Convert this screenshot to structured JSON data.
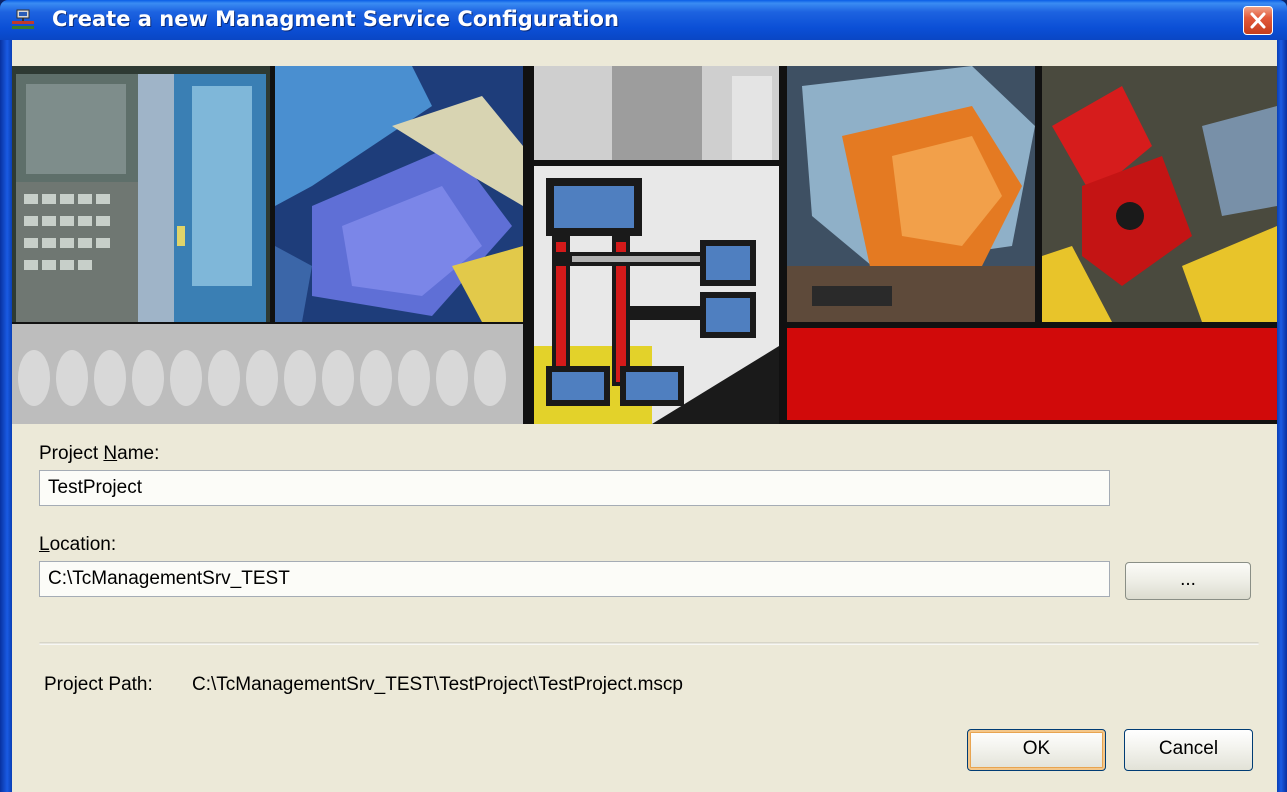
{
  "window": {
    "title": "Create a new Managment Service Configuration",
    "icon": "app-network-icon",
    "close_icon": "close-icon"
  },
  "banner": {
    "image": "industrial-automation-collage"
  },
  "form": {
    "project_name_label_prefix": "Project ",
    "project_name_label_mnemonic": "N",
    "project_name_label_suffix": "ame:",
    "project_name_value": "TestProject",
    "location_label_mnemonic": "L",
    "location_label_suffix": "ocation:",
    "location_value": "C:\\TcManagementSrv_TEST",
    "browse_label": "...",
    "project_path_label": "Project Path:",
    "project_path_value": "C:\\TcManagementSrv_TEST\\TestProject\\TestProject.mscp"
  },
  "buttons": {
    "ok_label": "OK",
    "cancel_label": "Cancel"
  },
  "colors": {
    "titlebar": "#0b4fd6",
    "client_background": "#ece9d8",
    "close_button": "#e2593a",
    "button_border": "#003c74"
  }
}
